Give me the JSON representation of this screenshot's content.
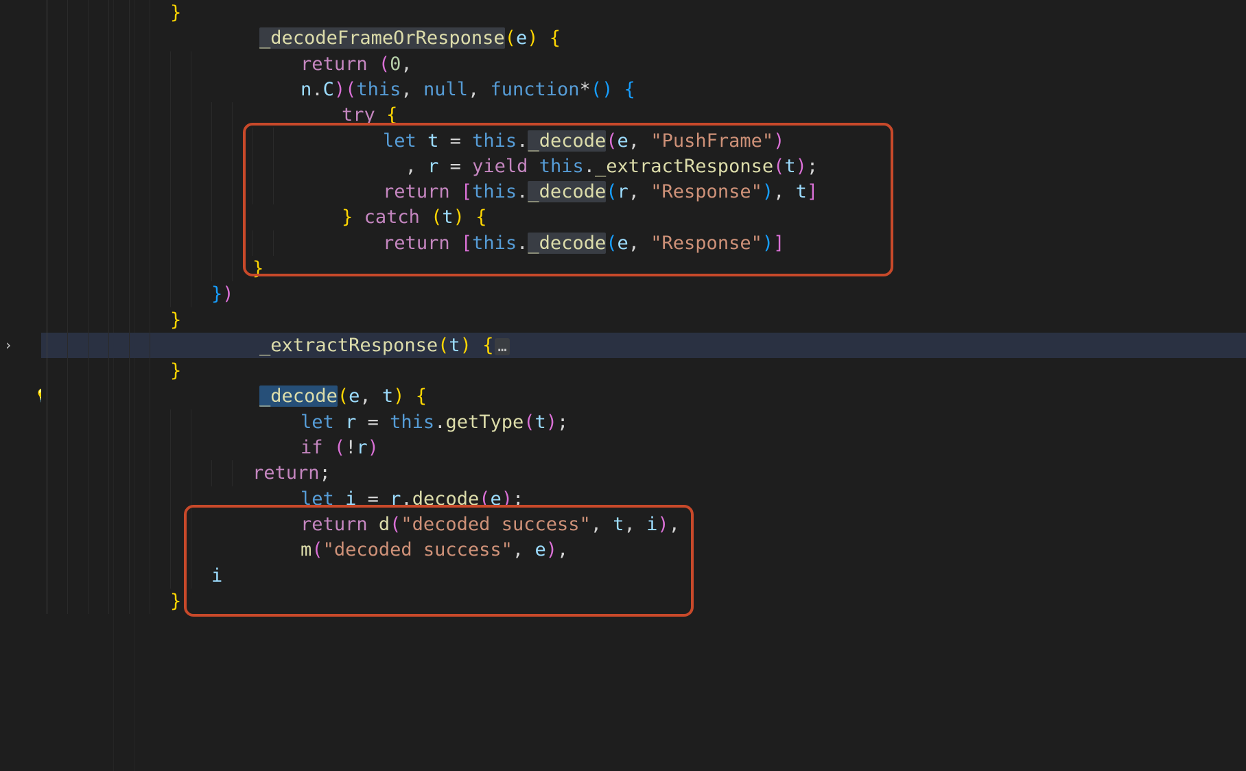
{
  "gutter": {
    "fold_caret_glyph": "›",
    "bulb_glyph": "💡"
  },
  "code": {
    "l01": {
      "brace_close": "}"
    },
    "l02": {
      "fn": "_decodeFrameOrResponse",
      "lp": "(",
      "p1": "e",
      "rp": ")",
      "sp": " ",
      "ob": "{"
    },
    "l03": {
      "kw_return": "return",
      "sp1": " ",
      "lp": "(",
      "num0": "0",
      "comma": ","
    },
    "l04": {
      "obj": "n",
      "dot": ".",
      "prop": "C",
      "rp_y": ")",
      "lp_y": "(",
      "this": "this",
      "c1": ",",
      "sp1": " ",
      "null": "null",
      "c2": ",",
      "sp2": " ",
      "kw_fn": "function",
      "star": "*",
      "lp2": "(",
      "rp2": ")",
      "sp3": " ",
      "ob": "{"
    },
    "l05": {
      "kw_try": "try",
      "sp": " ",
      "ob": "{"
    },
    "l06": {
      "kw_let": "let",
      "sp1": " ",
      "t": "t",
      "sp2": " ",
      "eq": "=",
      "sp3": " ",
      "this": "this",
      "dot": ".",
      "fn": "_decode",
      "lp": "(",
      "e": "e",
      "c": ",",
      "sp4": " ",
      "s": "\"PushFrame\"",
      "rp": ")"
    },
    "l07": {
      "lead_box": "  ",
      "c": ",",
      "sp1": " ",
      "r": "r",
      "sp2": " ",
      "eq": "=",
      "sp3": " ",
      "kw_yield": "yield",
      "sp4": " ",
      "this": "this",
      "dot": ".",
      "fn": "_extractResponse",
      "lp": "(",
      "t": "t",
      "rp": ")",
      "semi": ";"
    },
    "l08": {
      "kw_return": "return",
      "sp1": " ",
      "lb": "[",
      "this": "this",
      "dot": ".",
      "fn": "_decode",
      "lp": "(",
      "r": "r",
      "c1": ",",
      "sp2": " ",
      "s": "\"Response\"",
      "rp": ")",
      "c2": ",",
      "sp3": " ",
      "t": "t",
      "rb": "]"
    },
    "l09": {
      "cb": "}",
      "sp1": " ",
      "kw_catch": "catch",
      "sp2": " ",
      "lp": "(",
      "t": "t",
      "rp": ")",
      "sp3": " ",
      "ob": "{"
    },
    "l10": {
      "kw_return": "return",
      "sp1": " ",
      "lb": "[",
      "this": "this",
      "dot": ".",
      "fn": "_decode",
      "lp": "(",
      "e": "e",
      "c1": ",",
      "sp2": " ",
      "s": "\"Response\"",
      "rp": ")",
      "rb": "]"
    },
    "l11": {
      "cb": "}"
    },
    "l12": {
      "cb": "}",
      "rp": ")"
    },
    "l13": {
      "cb": "}"
    },
    "l14": {
      "fn": "_extractResponse",
      "lp": "(",
      "p1": "t",
      "rp": ")",
      "sp": " ",
      "ob": "{",
      "dots": "…"
    },
    "l15": {
      "cb": "}"
    },
    "l16": {
      "fn": "_decode",
      "lp": "(",
      "p1": "e",
      "c": ",",
      "sp": " ",
      "p2": "t",
      "rp": ")",
      "sp2": " ",
      "ob": "{"
    },
    "l17": {
      "kw_let": "let",
      "sp1": " ",
      "r": "r",
      "sp2": " ",
      "eq": "=",
      "sp3": " ",
      "this": "this",
      "dot": ".",
      "fn": "getType",
      "lp": "(",
      "t": "t",
      "rp": ")",
      "semi": ";"
    },
    "l18": {
      "kw_if": "if",
      "sp1": " ",
      "lp": "(",
      "not": "!",
      "r": "r",
      "rp": ")"
    },
    "l19": {
      "kw_return": "return",
      "semi": ";"
    },
    "l20": {
      "kw_let": "let",
      "sp1": " ",
      "i": "i",
      "sp2": " ",
      "eq": "=",
      "sp3": " ",
      "r": "r",
      "dot": ".",
      "fn": "decode",
      "lp": "(",
      "e": "e",
      "rp": ")",
      "semi": ";"
    },
    "l21": {
      "kw_return": "return",
      "sp1": " ",
      "dfn": "d",
      "lp": "(",
      "s": "\"decoded success\"",
      "c1": ",",
      "sp2": " ",
      "t": "t",
      "c2": ",",
      "sp3": " ",
      "i": "i",
      "rp": ")",
      "c3": ","
    },
    "l22": {
      "mfn": "m",
      "lp": "(",
      "s": "\"decoded success\"",
      "c1": ",",
      "sp2": " ",
      "e": "e",
      "rp": ")",
      "c2": ","
    },
    "l23": {
      "i": "i"
    },
    "l24": {
      "cb": "}"
    }
  }
}
